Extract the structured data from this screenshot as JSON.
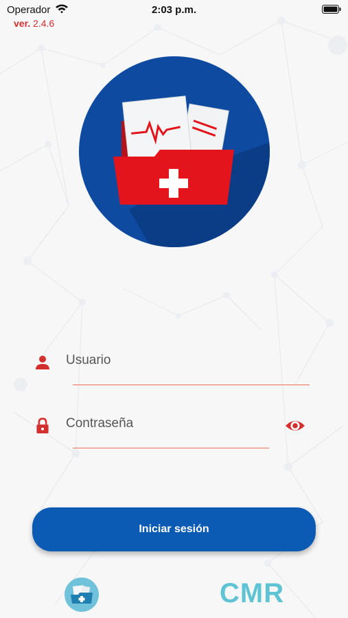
{
  "status_bar": {
    "carrier": "Operador",
    "time": "2:03 p.m.",
    "wifi_icon": "wifi-icon",
    "battery_icon": "battery-icon"
  },
  "version": {
    "prefix": "ver.",
    "number": "2.4.6"
  },
  "logo": {
    "icon": "medical-folder-icon",
    "circle_color": "#0d4aa0",
    "folder_color": "#e3141b"
  },
  "form": {
    "username": {
      "placeholder": "Usuario",
      "icon": "user-icon"
    },
    "password": {
      "placeholder": "Contraseña",
      "icon": "lock-icon",
      "toggle_icon": "eye-icon"
    },
    "accent_color": "#d32f2f",
    "underline_color": "#ef6c5a"
  },
  "login_button": {
    "label": "Iniciar sesión",
    "color": "#0b5ab3"
  },
  "footer": {
    "app_icon": "medical-folder-icon",
    "brand": "CMR",
    "brand_color": "#5ec3d2"
  }
}
